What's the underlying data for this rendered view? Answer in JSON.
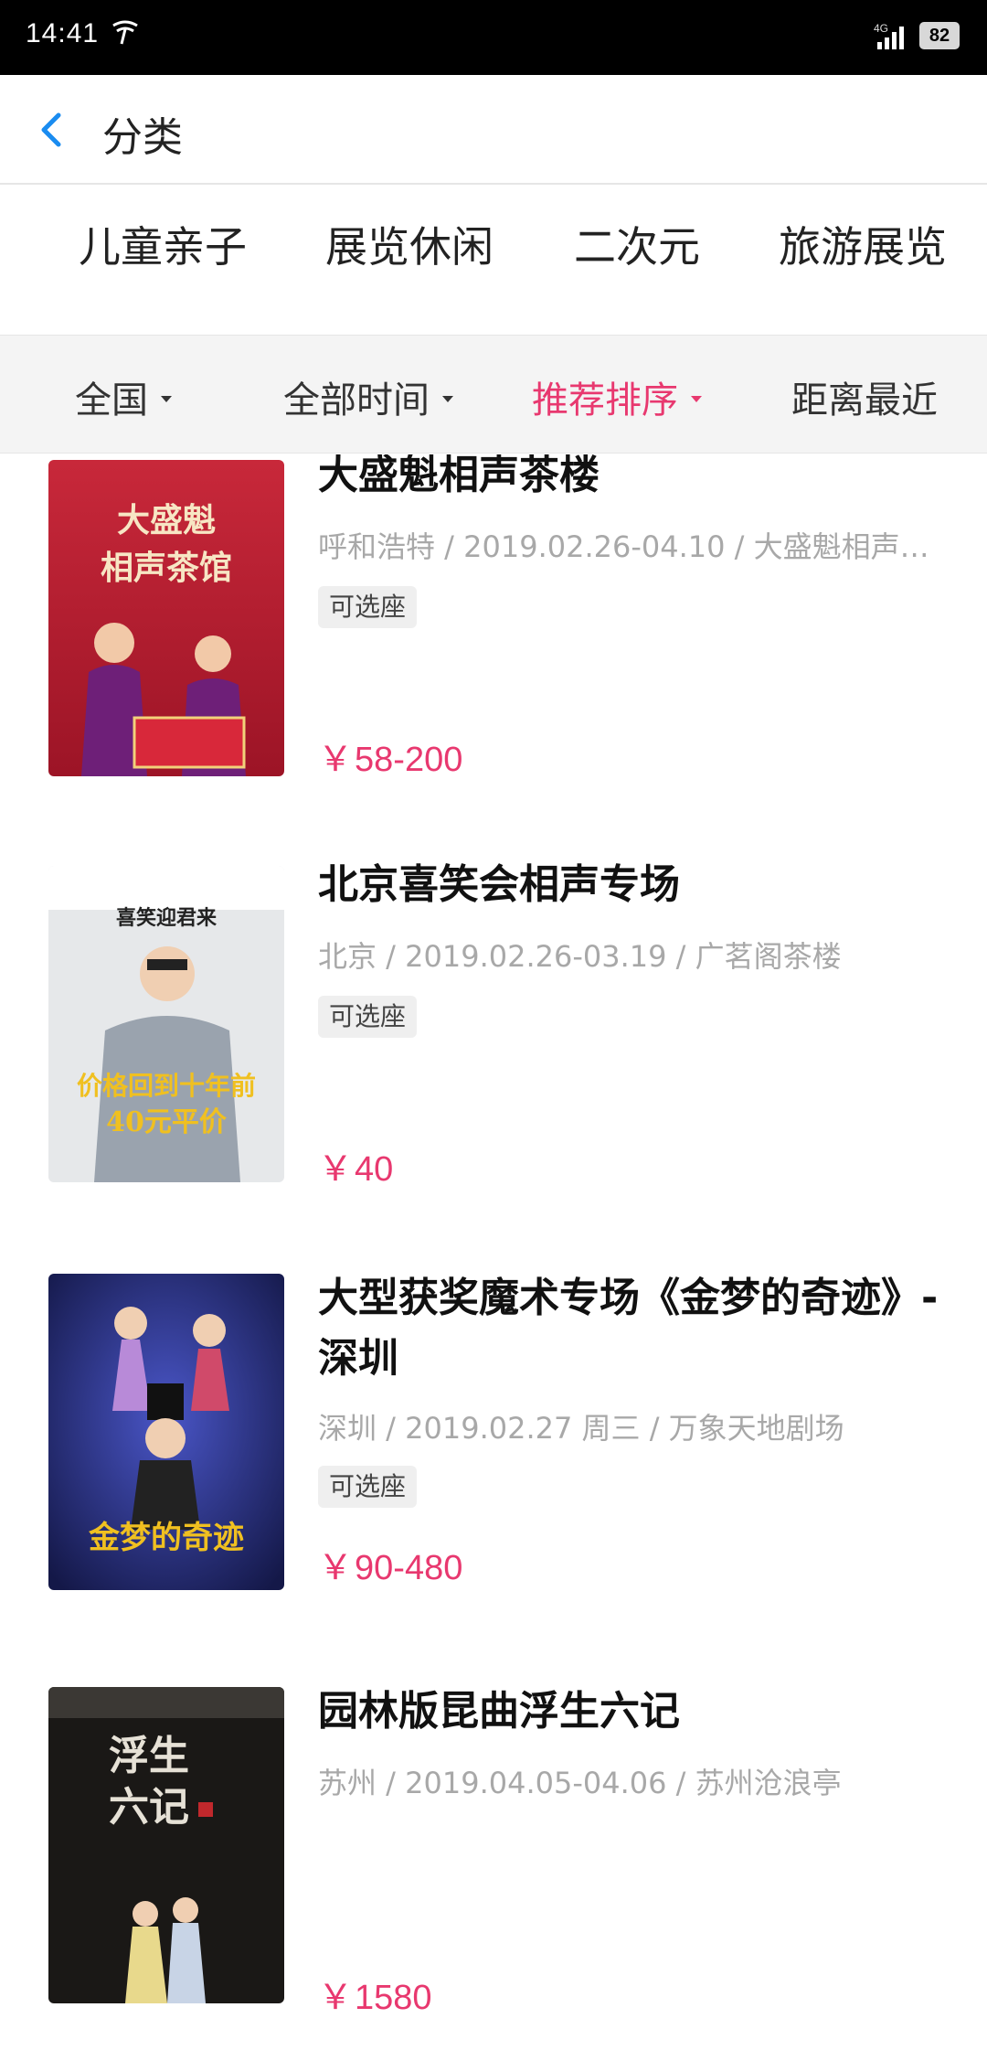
{
  "status_bar": {
    "time": "14:41",
    "network": "4G",
    "battery": "82"
  },
  "header": {
    "title": "分类"
  },
  "categories": [
    "儿童亲子",
    "展览休闲",
    "二次元",
    "旅游展览"
  ],
  "filters": [
    {
      "label": "全国",
      "active": false,
      "has_caret": true
    },
    {
      "label": "全部时间",
      "active": false,
      "has_caret": true
    },
    {
      "label": "推荐排序",
      "active": true,
      "has_caret": true
    },
    {
      "label": "距离最近",
      "active": false,
      "has_caret": false
    }
  ],
  "items": [
    {
      "title": "大盛魁相声茶楼",
      "meta": "呼和浩特 / 2019.02.26-04.10 / 大盛魁相声…",
      "badge": "可选座",
      "price": "58-200",
      "poster_text": "大盛魁\n相声茶馆"
    },
    {
      "title": "北京喜笑会相声专场",
      "meta": "北京 / 2019.02.26-03.19 / 广茗阁茶楼",
      "badge": "可选座",
      "price": "40",
      "poster_text": "喜笑迎君来"
    },
    {
      "title": "大型获奖魔术专场《金梦的奇迹》-深圳",
      "meta": "深圳 / 2019.02.27 周三 / 万象天地剧场",
      "badge": "可选座",
      "price": "90-480",
      "poster_text": "金梦的奇迹"
    },
    {
      "title": "园林版昆曲浮生六记",
      "meta": "苏州 / 2019.04.05-04.06 / 苏州沧浪亭",
      "badge": "",
      "price": "1580",
      "poster_text": "浮生六记"
    }
  ],
  "currency": "￥",
  "colors": {
    "accent": "#e8386f",
    "back_arrow": "#1a8cf0"
  }
}
